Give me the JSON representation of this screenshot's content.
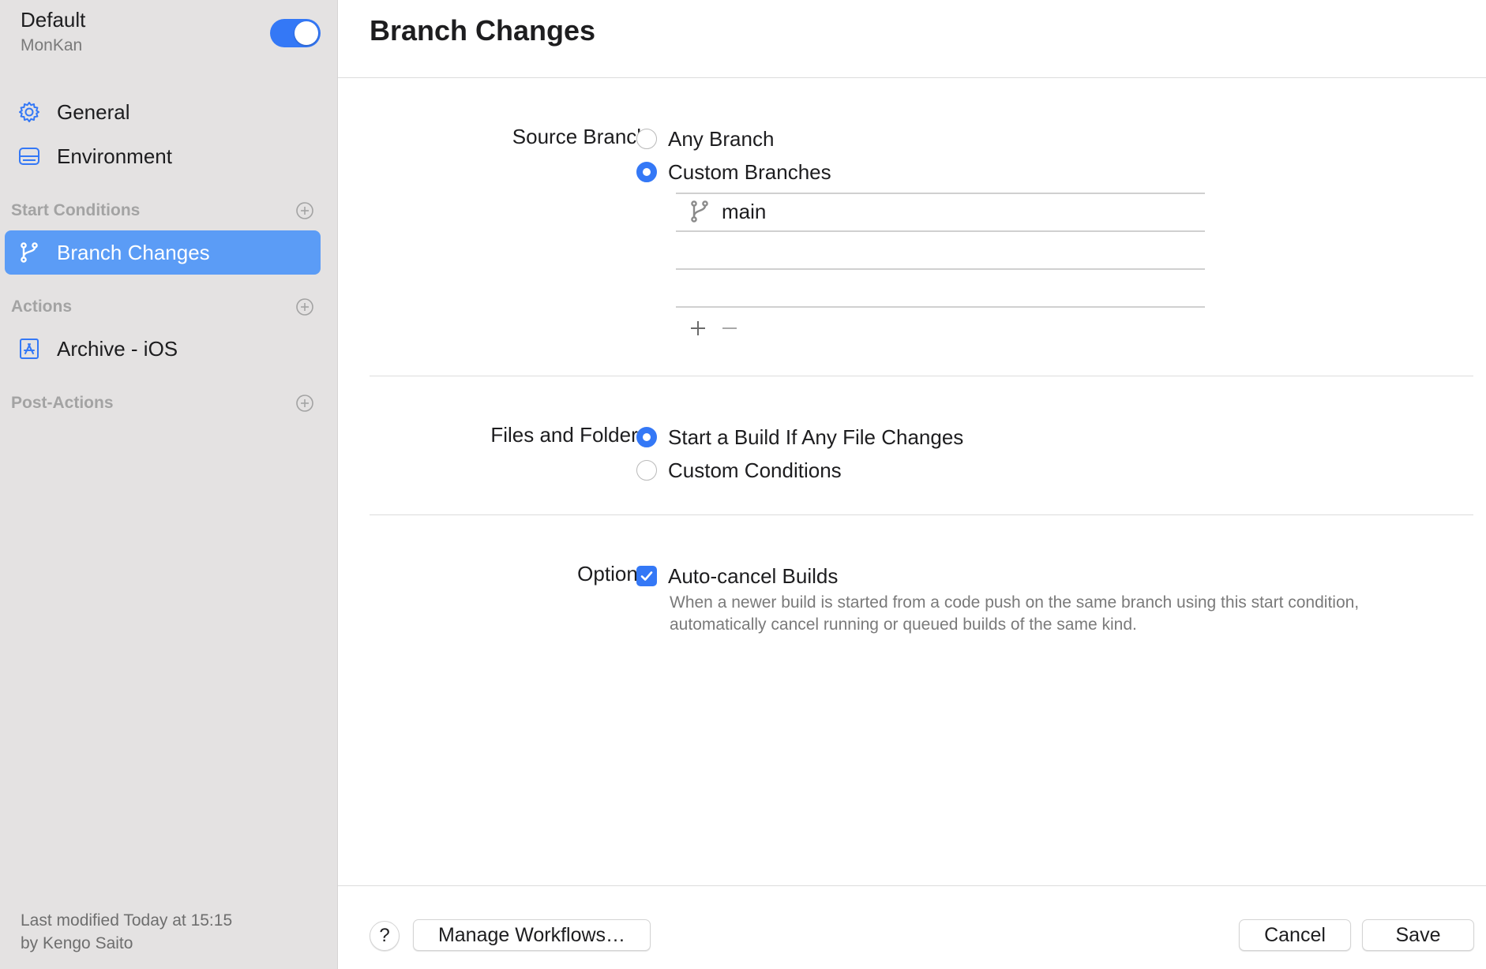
{
  "sidebar": {
    "workflow_name": "Default",
    "product_name": "MonKan",
    "enabled": true,
    "items": [
      {
        "label": "General",
        "icon": "gear-icon"
      },
      {
        "label": "Environment",
        "icon": "server-icon"
      }
    ],
    "start_conditions": {
      "title": "Start Conditions",
      "items": [
        {
          "label": "Branch Changes",
          "icon": "branch-icon",
          "selected": true
        }
      ]
    },
    "actions": {
      "title": "Actions",
      "items": [
        {
          "label": "Archive - iOS",
          "icon": "app-store-icon"
        }
      ]
    },
    "post_actions": {
      "title": "Post-Actions"
    },
    "last_modified_line1": "Last modified Today at 15:15",
    "last_modified_line2": "by Kengo Saito"
  },
  "main": {
    "title": "Branch Changes",
    "source_branch": {
      "label": "Source Branch:",
      "options": [
        {
          "label": "Any Branch",
          "selected": false
        },
        {
          "label": "Custom Branches",
          "selected": true
        }
      ],
      "branches": [
        "main"
      ]
    },
    "files_and_folders": {
      "label": "Files and Folders:",
      "options": [
        {
          "label": "Start a Build If Any File Changes",
          "selected": true
        },
        {
          "label": "Custom Conditions",
          "selected": false
        }
      ]
    },
    "options": {
      "label": "Options:",
      "auto_cancel": {
        "label": "Auto-cancel Builds",
        "checked": true,
        "description": "When a newer build is started from a code push on the same branch using this start condition, automatically cancel running or queued builds of the same kind."
      }
    }
  },
  "footer": {
    "help_label": "?",
    "manage_label": "Manage Workflows…",
    "cancel_label": "Cancel",
    "save_label": "Save"
  },
  "colors": {
    "accent": "#3478f6",
    "selection": "#5b9cf6",
    "sidebar_bg": "#e4e2e2"
  }
}
